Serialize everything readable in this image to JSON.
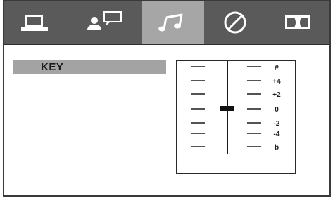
{
  "tabs": [
    {
      "icon": "monitor-icon",
      "active": false
    },
    {
      "icon": "person-speech-icon",
      "active": false
    },
    {
      "icon": "music-note-icon",
      "active": true
    },
    {
      "icon": "circle-slash-icon",
      "active": false
    },
    {
      "icon": "dolby-icon",
      "active": false
    }
  ],
  "key": {
    "label": "KEY",
    "scale": [
      "#",
      "+4",
      "+2",
      "0",
      "-2",
      "-4",
      "b"
    ],
    "current": "0"
  }
}
